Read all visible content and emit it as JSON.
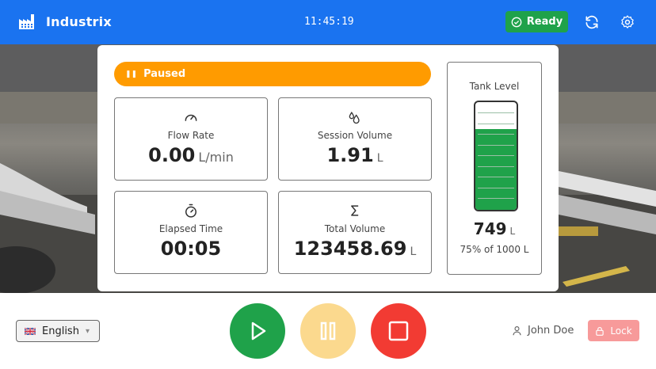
{
  "header": {
    "brand_name": "Industrix",
    "clock": "11:45:19",
    "status_label": "Ready",
    "refresh_icon": "refresh-icon",
    "settings_icon": "gear-icon",
    "colors": {
      "bar": "#1a73f0",
      "ready": "#1fa24a"
    }
  },
  "status_banner": {
    "label": "Paused",
    "color": "#ff9b00",
    "icon": "pause-icon"
  },
  "metrics": {
    "flow_rate": {
      "label": "Flow Rate",
      "value": "0.00",
      "unit": "L/min",
      "icon": "gauge-icon"
    },
    "session_volume": {
      "label": "Session Volume",
      "value": "1.91",
      "unit": "L",
      "icon": "droplets-icon"
    },
    "elapsed_time": {
      "label": "Elapsed Time",
      "value": "00:05",
      "icon": "stopwatch-icon"
    },
    "total_volume": {
      "label": "Total Volume",
      "value": "123458.69",
      "unit": "L",
      "icon": "sigma-icon"
    }
  },
  "tank": {
    "title": "Tank Level",
    "value": "749",
    "unit": "L",
    "percent_text": "75% of 1000 L",
    "level_fraction": 0.749,
    "fill_color": "#1fa24a"
  },
  "bottom": {
    "language": "English",
    "play_icon": "play-icon",
    "pause_icon": "pause-icon",
    "stop_icon": "stop-icon",
    "colors": {
      "play": "#1fa24a",
      "pause": "#fbd98e",
      "stop": "#f23b33",
      "lock": "#f79a9a"
    },
    "user_name": "John Doe",
    "lock_label": "Lock"
  }
}
